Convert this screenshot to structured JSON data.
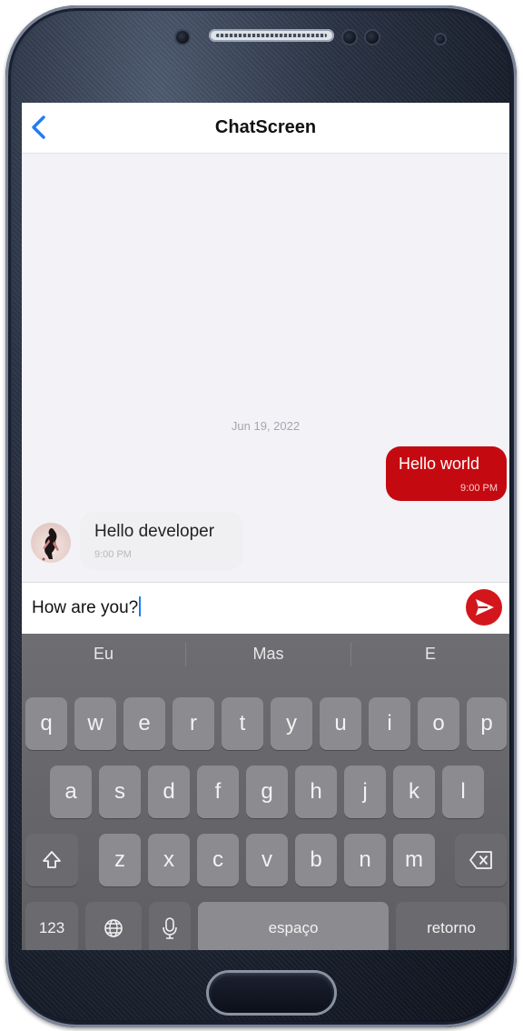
{
  "header": {
    "title": "ChatScreen",
    "back_icon": "chevron-left-icon"
  },
  "chat": {
    "date_separator": "Jun 19, 2022",
    "messages": [
      {
        "direction": "outgoing",
        "text": "Hello world",
        "time": "9:00 PM",
        "color": "#c40a10"
      },
      {
        "direction": "incoming",
        "text": "Hello developer",
        "time": "9:00 PM"
      }
    ]
  },
  "composer": {
    "value": "How are you?",
    "send_icon": "send-icon",
    "send_color": "#d3161b"
  },
  "keyboard": {
    "suggestions": [
      "Eu",
      "Mas",
      "E"
    ],
    "row1": [
      "q",
      "w",
      "e",
      "r",
      "t",
      "y",
      "u",
      "i",
      "o",
      "p"
    ],
    "row2": [
      "a",
      "s",
      "d",
      "f",
      "g",
      "h",
      "j",
      "k",
      "l"
    ],
    "row3": [
      "z",
      "x",
      "c",
      "v",
      "b",
      "n",
      "m"
    ],
    "numbers_key": "123",
    "space_key": "espaço",
    "return_key": "retorno"
  }
}
